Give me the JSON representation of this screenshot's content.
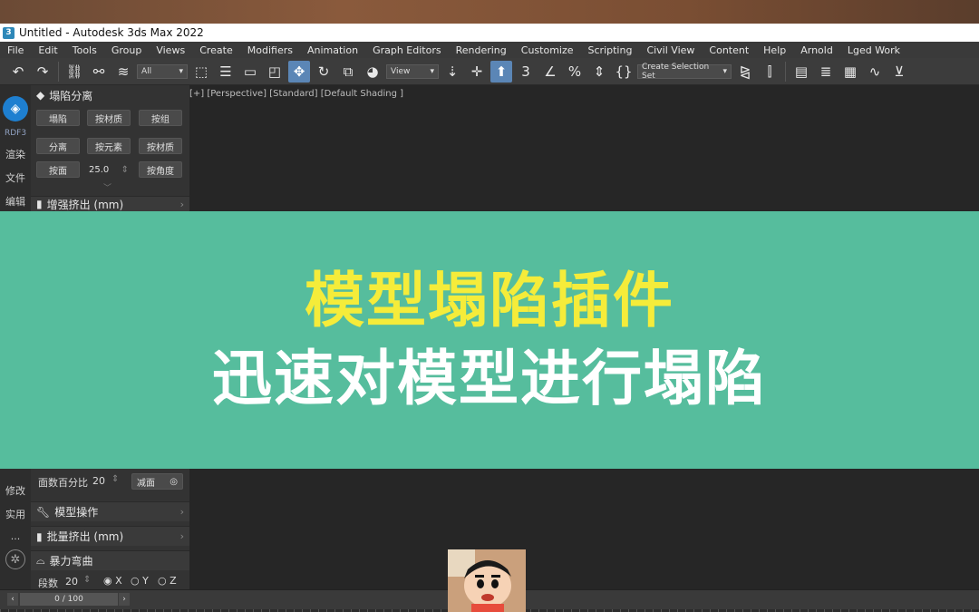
{
  "window": {
    "title": "Untitled - Autodesk 3ds Max 2022"
  },
  "menu": [
    "File",
    "Edit",
    "Tools",
    "Group",
    "Views",
    "Create",
    "Modifiers",
    "Animation",
    "Graph Editors",
    "Rendering",
    "Customize",
    "Scripting",
    "Civil View",
    "Content",
    "Help",
    "Arnold",
    "Lged Work"
  ],
  "toolbar": {
    "filter_value": "All",
    "coord_value": "View",
    "selection_set_placeholder": "Create Selection Set"
  },
  "leftbar": {
    "rdf_label": "RDF3",
    "items": [
      "渲染",
      "文件",
      "编辑"
    ],
    "items_bottom": [
      "修改",
      "实用",
      "..."
    ]
  },
  "panel": {
    "title": "塌陷分离",
    "row1": [
      "塌陷",
      "按材质",
      "按组"
    ],
    "row2": [
      "分离",
      "按元素",
      "按材质"
    ],
    "row3_left": "按面",
    "row3_value": "25.0",
    "row3_right": "按角度",
    "next_rollout": "增强挤出 (mm)"
  },
  "viewport": {
    "label": "[+] [Perspective] [Standard] [Default Shading ]"
  },
  "banner": {
    "line1": "模型塌陷插件",
    "line2": "迅速对模型进行塌陷",
    "line1_color": "#f5ec3a",
    "line2_color": "#ffffff",
    "bg_color": "#56bd9d"
  },
  "lower_panel": {
    "face_percent_label": "面数百分比",
    "face_percent_value": "20",
    "reduce_label": "减面",
    "rollouts": [
      "模型操作",
      "批量挤出 (mm)",
      "暴力弯曲"
    ],
    "segments_label": "段数",
    "segments_value": "20",
    "axes": [
      "X",
      "Y",
      "Z"
    ],
    "selected_axis": "X"
  },
  "timeline": {
    "frame_label": "0 / 100"
  }
}
